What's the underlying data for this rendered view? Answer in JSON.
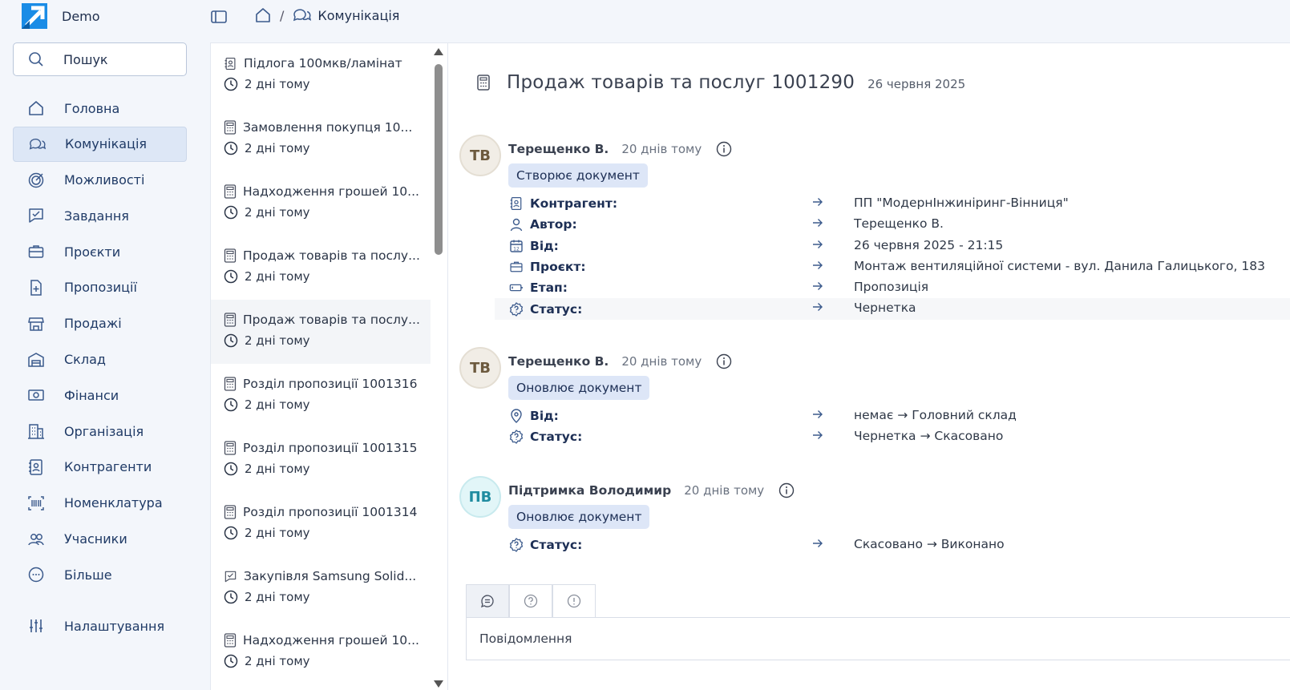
{
  "app": {
    "name": "Demo"
  },
  "search": {
    "label": "Пошук"
  },
  "nav": [
    {
      "label": "Головна",
      "icon": "home-icon"
    },
    {
      "label": "Комунікація",
      "icon": "chat-icon",
      "active": true
    },
    {
      "label": "Можливості",
      "icon": "target-icon"
    },
    {
      "label": "Завдання",
      "icon": "task-icon"
    },
    {
      "label": "Проєкти",
      "icon": "briefcase-icon"
    },
    {
      "label": "Пропозиції",
      "icon": "proposal-icon"
    },
    {
      "label": "Продажі",
      "icon": "store-icon"
    },
    {
      "label": "Склад",
      "icon": "warehouse-icon"
    },
    {
      "label": "Фінанси",
      "icon": "money-icon"
    },
    {
      "label": "Організація",
      "icon": "building-icon"
    },
    {
      "label": "Контрагенти",
      "icon": "contact-icon"
    },
    {
      "label": "Номенклатура",
      "icon": "barcode-icon"
    },
    {
      "label": "Учасники",
      "icon": "users-icon"
    },
    {
      "label": "Більше",
      "icon": "more-icon"
    }
  ],
  "settings": {
    "label": "Налаштування"
  },
  "breadcrumb": {
    "current": "Комунікація"
  },
  "list": [
    {
      "title": "Підлога 100мкв/ламінат",
      "time": "2 дні тому",
      "icon": "contact-icon"
    },
    {
      "title": "Замовлення покупця 10...",
      "time": "2 дні тому",
      "icon": "calculator-icon"
    },
    {
      "title": "Надходження грошей 10...",
      "time": "2 дні тому",
      "icon": "calculator-icon"
    },
    {
      "title": "Продаж товарів та послу...",
      "time": "2 дні тому",
      "icon": "calculator-icon"
    },
    {
      "title": "Продаж товарів та послу...",
      "time": "2 дні тому",
      "icon": "calculator-icon",
      "selected": true
    },
    {
      "title": "Розділ пропозиції 1001316",
      "time": "2 дні тому",
      "icon": "calculator-icon"
    },
    {
      "title": "Розділ пропозиції 1001315",
      "time": "2 дні тому",
      "icon": "calculator-icon"
    },
    {
      "title": "Розділ пропозиції 1001314",
      "time": "2 дні тому",
      "icon": "calculator-icon"
    },
    {
      "title": "Закупівля Samsung Solid...",
      "time": "2 дні тому",
      "icon": "task-icon"
    },
    {
      "title": "Надходження грошей 10...",
      "time": "2 дні тому",
      "icon": "calculator-icon"
    }
  ],
  "document": {
    "title": "Продаж товарів та послуг 1001290",
    "date": "26 червня 2025"
  },
  "events": [
    {
      "initials": "ТВ",
      "author": "Терещенко В.",
      "ago": "20 днів тому",
      "action": "Створює документ",
      "fields": [
        {
          "icon": "contact-icon",
          "label": "Контрагент:",
          "value": "ПП \"МодернІнжиніринг-Вінниця\""
        },
        {
          "icon": "user-icon",
          "label": "Автор:",
          "value": "Терещенко В."
        },
        {
          "icon": "calendar-icon",
          "label": "Від:",
          "value": "26 червня 2025 - 21:15"
        },
        {
          "icon": "briefcase-icon",
          "label": "Проєкт:",
          "value": "Монтаж вентиляційної системи - вул. Данила Галицького, 183"
        },
        {
          "icon": "battery-icon",
          "label": "Етап:",
          "value": "Пропозиція"
        },
        {
          "icon": "status-icon",
          "label": "Статус:",
          "value": "Чернетка"
        }
      ]
    },
    {
      "initials": "ТВ",
      "author": "Терещенко В.",
      "ago": "20 днів тому",
      "action": "Оновлює документ",
      "fields": [
        {
          "icon": "location-icon",
          "label": "Від:",
          "value": "немає → Головний склад"
        },
        {
          "icon": "status-icon",
          "label": "Статус:",
          "value": "Чернетка → Скасовано"
        }
      ]
    },
    {
      "initials": "ПВ",
      "author": "Підтримка Володимир",
      "ago": "20 днів тому",
      "action": "Оновлює документ",
      "fields": [
        {
          "icon": "status-icon",
          "label": "Статус:",
          "value": "Скасовано → Виконано"
        }
      ]
    }
  ],
  "composer": {
    "placeholder": "Повідомлення"
  },
  "colors": {
    "accent": "#1a8ce6",
    "active_bg": "#dde7f6",
    "badge_bg": "#dde6f7",
    "icon": "#3b5a8c"
  }
}
